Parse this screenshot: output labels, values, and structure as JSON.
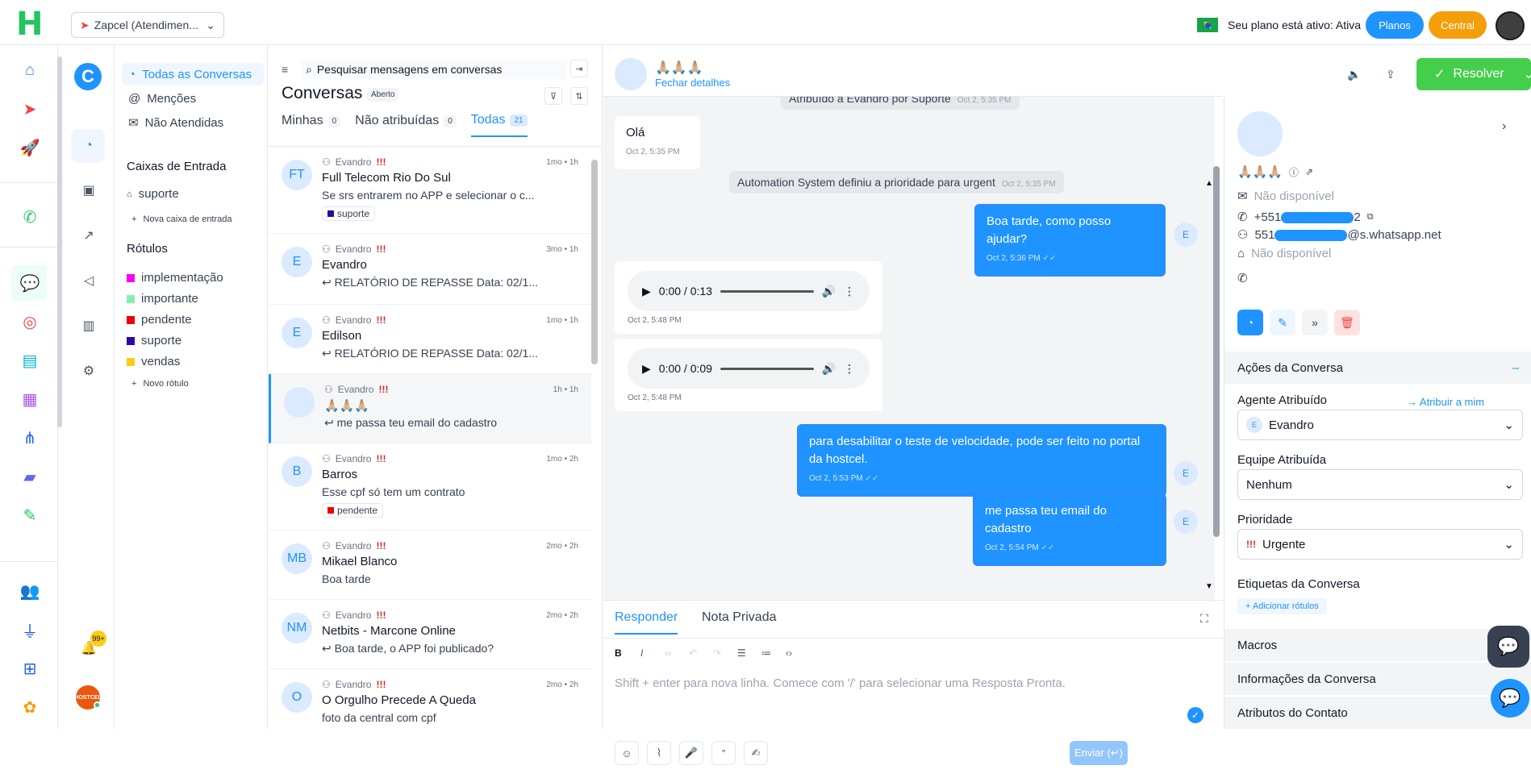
{
  "topbar": {
    "logo": "H",
    "account": "Zapcel (Atendimen...",
    "plan_text": "Seu plano está ativo: Ativa",
    "btn_planos": "Planos",
    "btn_central": "Central"
  },
  "sidebar": {
    "nav": [
      "Todas as Conversas",
      "Menções",
      "Não Atendidas"
    ],
    "inbox_title": "Caixas de Entrada",
    "inboxes": [
      "suporte"
    ],
    "new_inbox": "Nova caixa de entrada",
    "labels_title": "Rótulos",
    "labels": [
      {
        "name": "implementação",
        "color": "#f0e"
      },
      {
        "name": "importante",
        "color": "#86efac"
      },
      {
        "name": "pendente",
        "color": "#ef0000"
      },
      {
        "name": "suporte",
        "color": "#2a0aa0"
      },
      {
        "name": "vendas",
        "color": "#facc15"
      }
    ],
    "new_label": "Novo rótulo",
    "notif_count": "99+",
    "org": "HOSTCEL"
  },
  "list": {
    "search_placeholder": "Pesquisar mensagens em conversas",
    "title": "Conversas",
    "status": "Aberto",
    "tabs": [
      {
        "label": "Minhas",
        "count": "0"
      },
      {
        "label": "Não atribuídas",
        "count": "0"
      },
      {
        "label": "Todas",
        "count": "21"
      }
    ],
    "items": [
      {
        "initials": "FT",
        "agent": "Evandro",
        "pri": "!!!",
        "time": "1mo • 1h",
        "name": "Full Telecom Rio Do Sul",
        "msg": "Se srs entrarem no APP e selecionar o c...",
        "tag": "suporte",
        "tagcolor": "#2a0aa0"
      },
      {
        "initials": "E",
        "agent": "Evandro",
        "pri": "!!!",
        "time": "3mo • 1h",
        "name": "Evandro",
        "msg": "↩ RELATÓRIO DE REPASSE Data: 02/1...",
        "tag": "",
        "tagcolor": ""
      },
      {
        "initials": "E",
        "agent": "Evandro",
        "pri": "!!!",
        "time": "1mo • 1h",
        "name": "Edilson",
        "msg": "↩ RELATÓRIO DE REPASSE Data: 02/1...",
        "tag": "",
        "tagcolor": ""
      },
      {
        "initials": "",
        "agent": "Evandro",
        "pri": "!!!",
        "time": "1h • 1h",
        "name": "🙏🏼🙏🏼🙏🏼",
        "msg": "↩ me passa teu email do cadastro",
        "tag": "",
        "tagcolor": ""
      },
      {
        "initials": "B",
        "agent": "Evandro",
        "pri": "!!!",
        "time": "1mo • 2h",
        "name": "Barros",
        "msg": "Esse cpf só tem um contrato",
        "tag": "pendente",
        "tagcolor": "#ef0000"
      },
      {
        "initials": "MB",
        "agent": "Evandro",
        "pri": "!!!",
        "time": "2mo • 2h",
        "name": "Mikael Blanco",
        "msg": "Boa tarde",
        "tag": "",
        "tagcolor": ""
      },
      {
        "initials": "NM",
        "agent": "Evandro",
        "pri": "!!!",
        "time": "2mo • 2h",
        "name": "Netbits - Marcone Online",
        "msg": "↩ Boa tarde, o APP foi publicado?",
        "tag": "",
        "tagcolor": ""
      },
      {
        "initials": "O",
        "agent": "Evandro",
        "pri": "!!!",
        "time": "2mo • 2h",
        "name": "O Orgulho Precede A Queda",
        "msg": "foto da central com cpf",
        "tag": "",
        "tagcolor": ""
      }
    ]
  },
  "chat": {
    "name": "🙏🏼🙏🏼🙏🏼",
    "close_details": "Fechar detalhes",
    "resolve": "Resolver",
    "activity1": "Atribuído a Evandro por Suporte",
    "activity1_time": "Oct 2, 5:35 PM",
    "msg1": "Olá",
    "msg1_time": "Oct 2, 5:35 PM",
    "activity2": "Automation System definiu a prioridade para urgent",
    "activity2_time": "Oct 2, 5:35 PM",
    "msg2": "Boa tarde, como posso ajudar?",
    "msg2_time": "Oct 2, 5:36 PM",
    "audio1": "0:00 / 0:13",
    "audio1_time": "Oct 2, 5:48 PM",
    "audio2": "0:00 / 0:09",
    "audio2_time": "Oct 2, 5:48 PM",
    "msg3": "para desabilitar o teste de velocidade, pode ser feito no portal da hostcel.",
    "msg3_time": "Oct 2, 5:53 PM",
    "msg4": "me passa teu email do cadastro",
    "msg4_time": "Oct 2, 5:54 PM",
    "agent_initial": "E",
    "reply_tab": "Responder",
    "note_tab": "Nota Privada",
    "placeholder": "Shift + enter para nova linha. Comece com '/' para selecionar uma Resposta Pronta.",
    "send": "Enviar (↵)"
  },
  "details": {
    "name": "🙏🏼🙏🏼🙏🏼",
    "email": "Não disponível",
    "phone_prefix": "+551",
    "phone_suffix": "2",
    "wa_prefix": "551",
    "wa_suffix": "@s.whatsapp.net",
    "company": "Não disponível",
    "actions_title": "Ações da Conversa",
    "agent_label": "Agente Atribuído",
    "assign_me": "Atribuir a mim",
    "agent_value": "Evandro",
    "team_label": "Equipe Atribuída",
    "team_value": "Nenhum",
    "priority_label": "Prioridade",
    "priority_value": "Urgente",
    "labels_label": "Etiquetas da Conversa",
    "add_label": "Adicionar rótulos",
    "macros": "Macros",
    "conv_info": "Informações da Conversa",
    "contact_attrs": "Atributos do Contato"
  }
}
